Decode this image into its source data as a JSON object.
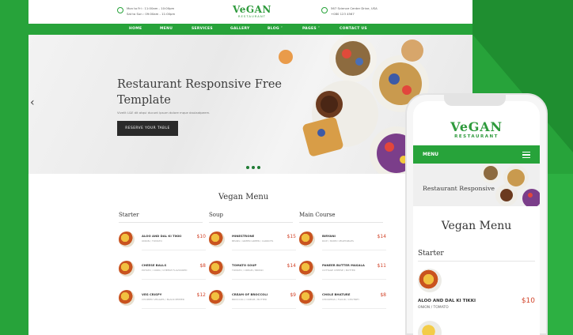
{
  "desktop": {
    "header": {
      "hours": [
        "Mon to Fri : 11:00am - 10:00pm",
        "Sat to Sun : 09:00am - 11:00pm"
      ],
      "logo_main": "VeGAN",
      "logo_sub": "RESTAURANT",
      "address": [
        "567 Science Center Drive, USA",
        "+080 123 4567"
      ]
    },
    "nav": [
      "HOME",
      "MENU",
      "SERVICES",
      "GALLERY",
      "BLOG ˅",
      "PAGES ˅",
      "CONTACT US"
    ],
    "hero": {
      "title": "Restaurant Responsive Free Template",
      "subtitle": "Vivelit L&E dit atqui ducunt ipsum dolore mque daulaatpeem.",
      "button": "RESERVE YOUR TABLE",
      "prev_arrow": "‹"
    },
    "menu": {
      "title": "Vegan Menu",
      "columns": [
        {
          "heading": "Starter",
          "items": [
            {
              "name": "ALOO AND DAL KI TIKKI",
              "desc": "ONION / TOMATO",
              "price": "$10"
            },
            {
              "name": "CHEESE BALLS",
              "desc": "POTATO / CORN / CHEESE FLAVOURED",
              "price": "$8"
            },
            {
              "name": "VEG CRISPY",
              "desc": "CHOPPED VEGGIES / BLACK PEPPER",
              "price": "$12"
            }
          ]
        },
        {
          "heading": "Soup",
          "items": [
            {
              "name": "MINESTRONE",
              "desc": "BEANS / GREEN GREEN / CARROTS",
              "price": "$15"
            },
            {
              "name": "TOMATO SOUP",
              "desc": "TOMATO / CREAM / BREAD",
              "price": "$14"
            },
            {
              "name": "CREAM OF BROCCOLI",
              "desc": "BROCCOLI / CREAM / BUTTER",
              "price": "$9"
            }
          ]
        },
        {
          "heading": "Main Course",
          "items": [
            {
              "name": "BIRYANI",
              "desc": "RICE / MIXED VEGETABLES",
              "price": "$14"
            },
            {
              "name": "PANEER BUTTER MASALA",
              "desc": "COTTAGE CHEESE / BUTTER",
              "price": "$11"
            },
            {
              "name": "CHOLE BHATURE",
              "desc": "CHICKPEAS / FLOUR / CHUTNEY",
              "price": "$8"
            }
          ]
        }
      ]
    }
  },
  "mobile": {
    "logo_main": "VeGAN",
    "logo_sub": "RESTAURANT",
    "menu_label": "MENU",
    "hero_title": "Restaurant Responsive",
    "menu_title": "Vegan Menu",
    "section": "Starter",
    "item": {
      "name": "ALOO AND DAL KI TIKKI",
      "desc": "ONION / TOMATO",
      "price": "$10"
    }
  },
  "colors": {
    "brand_green": "#27a33a",
    "price_red": "#d2452b",
    "dark_button": "#2a2a2a"
  }
}
